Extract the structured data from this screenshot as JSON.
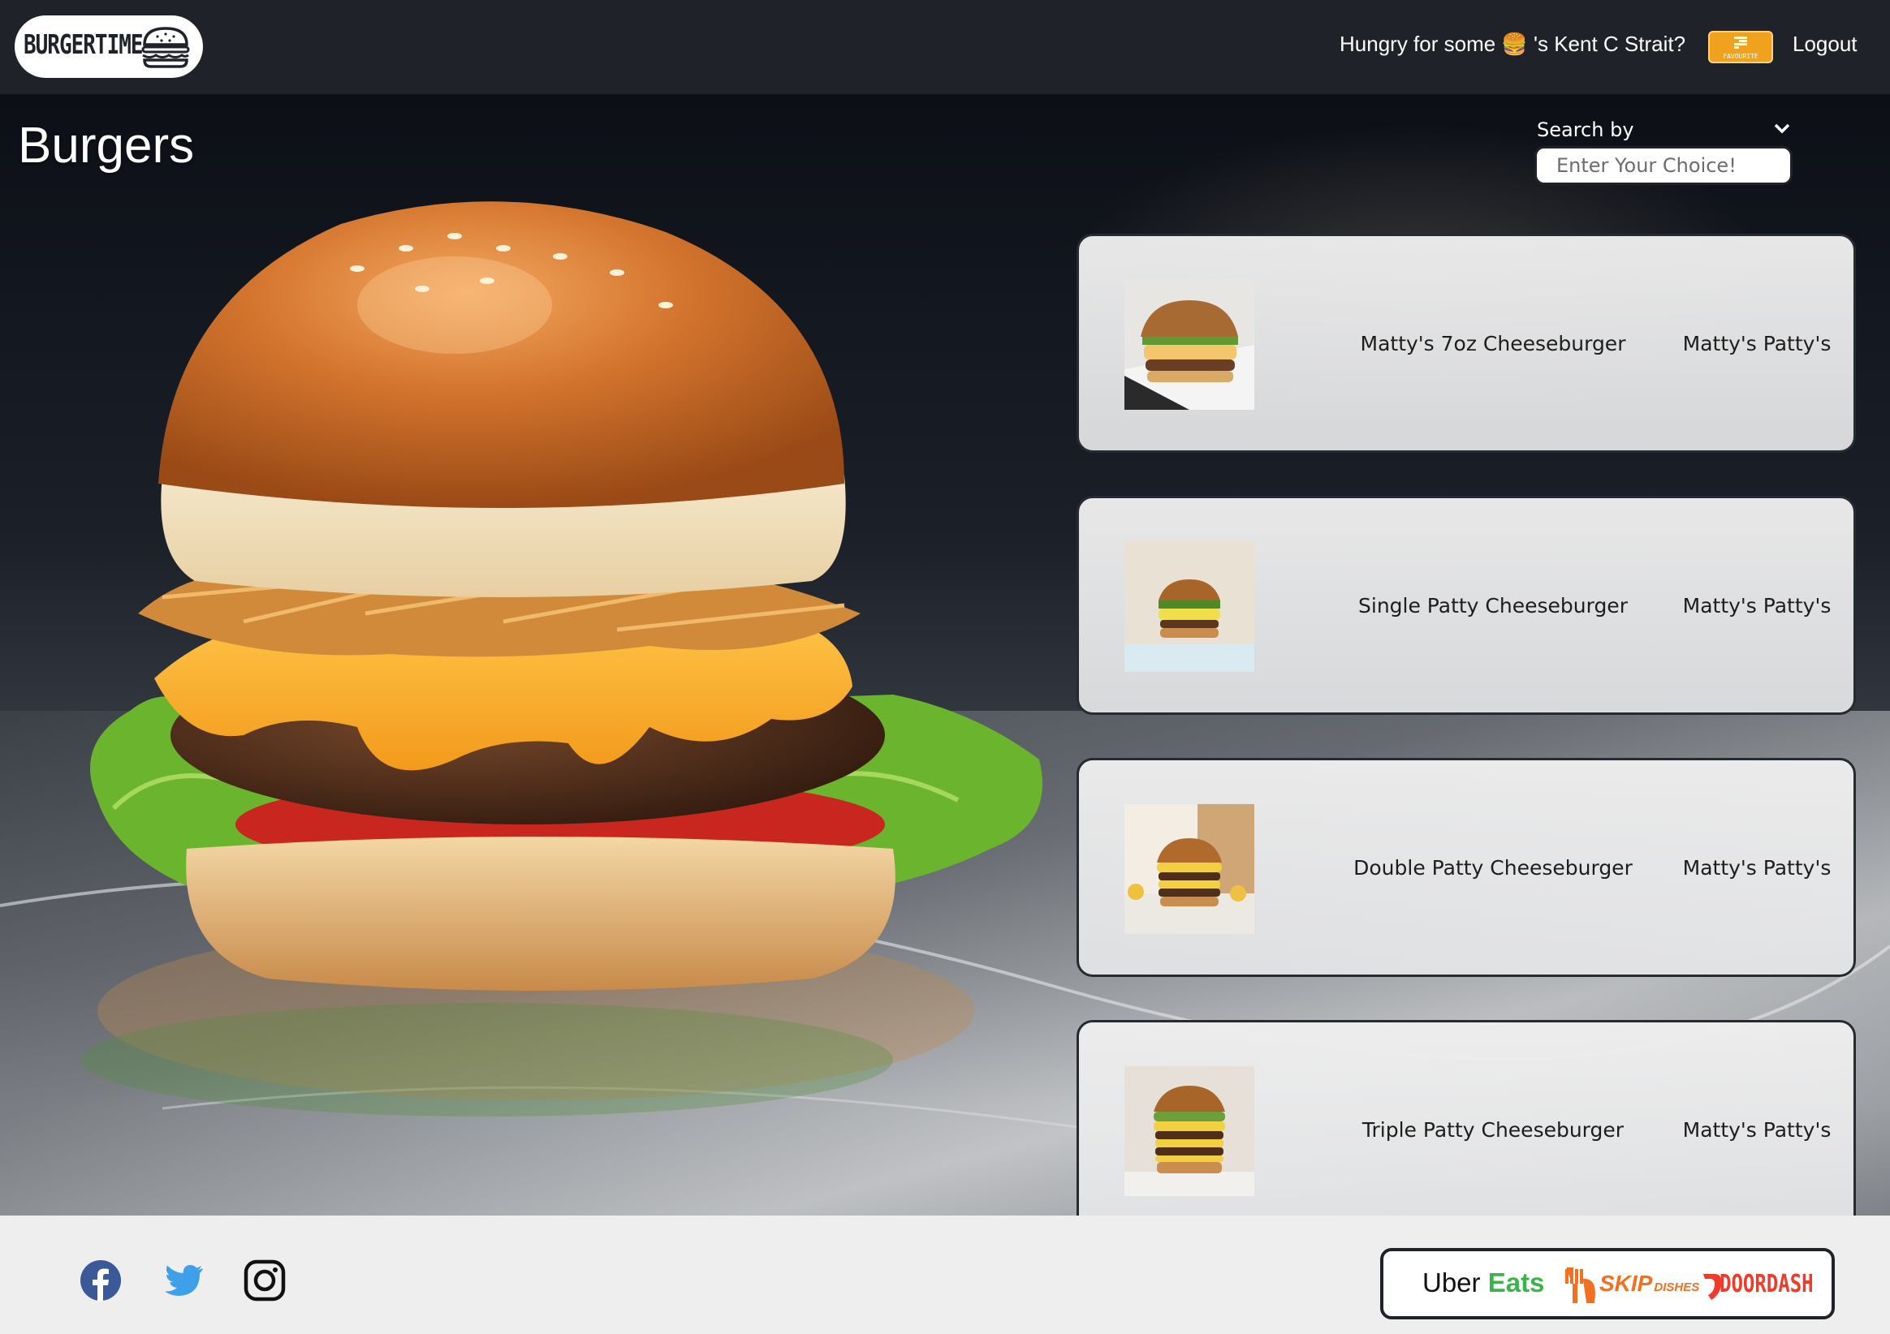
{
  "brand": {
    "name": "BURGERTIME",
    "icon": "burger-icon"
  },
  "nav": {
    "greeting_prefix": "Hungry for some",
    "greeting_emoji": "🍔",
    "greeting_suffix": "'s Kent C Strait?",
    "favourites_label": "FAVOURITE",
    "favourites_icon": "favourites-badge-icon",
    "logout_label": "Logout"
  },
  "page": {
    "title": "Burgers"
  },
  "search": {
    "label": "Search by",
    "placeholder": "Enter Your Choice!",
    "value": ""
  },
  "results": [
    {
      "name": "Matty's 7oz Cheeseburger",
      "restaurant": "Matty's Patty's"
    },
    {
      "name": "Single Patty Cheeseburger",
      "restaurant": "Matty's Patty's"
    },
    {
      "name": "Double Patty Cheeseburger",
      "restaurant": "Matty's Patty's"
    },
    {
      "name": "Triple Patty Cheeseburger",
      "restaurant": "Matty's Patty's"
    }
  ],
  "footer": {
    "social": [
      "facebook-icon",
      "twitter-icon",
      "instagram-icon"
    ],
    "delivery": {
      "uber_1": "Uber",
      "uber_2": "Eats",
      "skip": "SKIP",
      "skip_small": "DISHES",
      "doordash": "DOORDASH"
    }
  },
  "colors": {
    "navbar": "#1f2329",
    "favourite": "#f0a11e",
    "card": "#eeeeee",
    "footer": "#eeeeee",
    "uber_green": "#3ab54a",
    "skip_orange": "#f37021",
    "doordash_red": "#ef3b2c"
  }
}
